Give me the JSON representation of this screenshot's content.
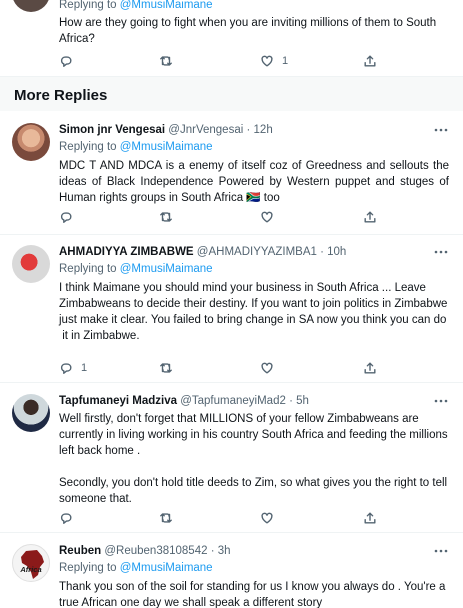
{
  "top_tweet": {
    "replying_prefix": "Replying to",
    "replying_to": "@MmusiMaimane",
    "text": "How are they going to fight when you are inviting millions of them to South Africa?",
    "like_count": "1"
  },
  "section": {
    "title": "More Replies"
  },
  "replies": [
    {
      "name": "Simon jnr Vengesai",
      "handle": "@JnrVengesai",
      "time": "12h",
      "replying_prefix": "Replying to",
      "replying_to": "@MmusiMaimane",
      "text": "MDC T AND MDCA is a enemy of itself  coz of Greedness  and sellouts  the ideas  of Black Independence  Powered by Western  puppet  and stuges of Human  rights  groups  in South Africa 🇿🇦  too"
    },
    {
      "name": "AHMADIYYA ZIMBABWE",
      "handle": "@AHMADIYYAZIMBA1",
      "time": "10h",
      "replying_prefix": "Replying to",
      "replying_to": "@MmusiMaimane",
      "text_lines": [
        "I think Maimane you should mind your business in South Africa ... Leave Zimbabweans to decide their destiny. If you want to join politics in Zimbabwe just make it clear. You failed to bring change in SA now you think you can do",
        " it in Zimbabwe."
      ],
      "reply_count": "1"
    },
    {
      "name": "Tapfumaneyi Madziva",
      "handle": "@TapfumaneyiMad2",
      "time": "5h",
      "text_lines": [
        "Well firstly, don't forget that MILLIONS of your fellow Zimbabweans are currently in living working in his country South Africa and feeding the millions left back home .",
        "",
        "Secondly, you don't hold title deeds to Zim, so what gives you the right to tell someone that."
      ]
    },
    {
      "name": "Reuben",
      "handle": "@Reuben38108542",
      "time": "3h",
      "replying_prefix": "Replying to",
      "replying_to": "@MmusiMaimane",
      "text": "Thank you son of the soil for standing for us I know you always do . You're a true African one day we shall speak a different story",
      "avatar_text": "Africa"
    }
  ],
  "colors": {
    "accent": "#1d9bf0",
    "muted": "#536471",
    "text": "#0f1419",
    "border": "#eff3f4",
    "section_bg": "#f7f9f9"
  },
  "icons": [
    "reply-icon",
    "retweet-icon",
    "like-icon",
    "share-icon",
    "more-icon"
  ]
}
